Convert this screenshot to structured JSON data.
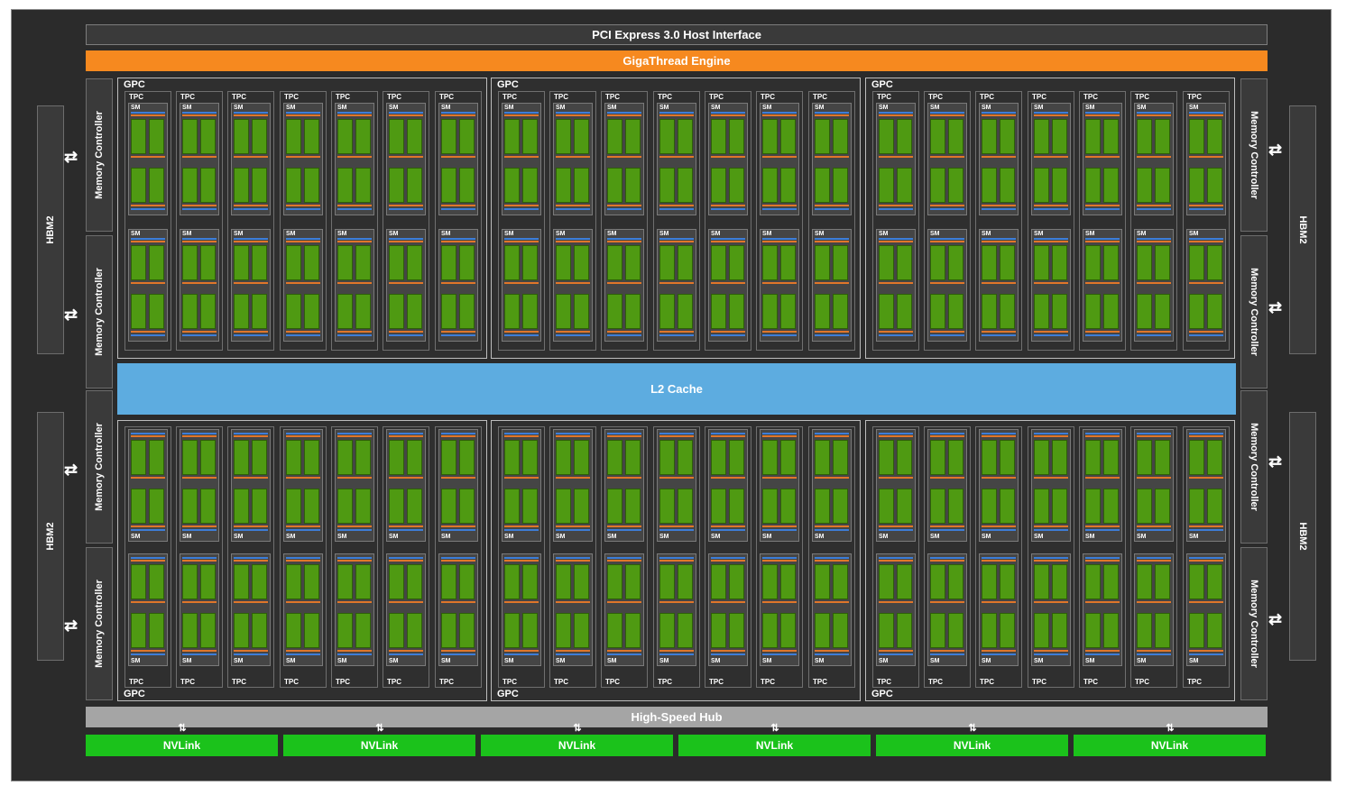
{
  "pcie": "PCI Express 3.0 Host Interface",
  "gigathread": "GigaThread Engine",
  "l2": "L2 Cache",
  "hub": "High-Speed Hub",
  "hbm_label": "HBM2",
  "mc_label": "Memory Controller",
  "gpc_label": "GPC",
  "tpc_label": "TPC",
  "sm_label": "SM",
  "nvlink_label": "NVLink",
  "arrow_glyph": "⇄",
  "nv_arrow_glyph": "⇅",
  "counts": {
    "gpcs": 6,
    "tpcs_per_gpc": 7,
    "sms_per_tpc": 2,
    "nvlinks": 6,
    "hbm_stacks": 4,
    "memory_controllers": 8
  },
  "colors": {
    "background": "#2b2b2b",
    "gigathread": "#f6891f",
    "l2": "#5dace0",
    "hub": "#a5a5a5",
    "nvlink": "#1bc21b",
    "core": "#4f9a12",
    "sm_top_bar": "#3d7dd8",
    "sm_mid_bar": "#e0762a"
  }
}
